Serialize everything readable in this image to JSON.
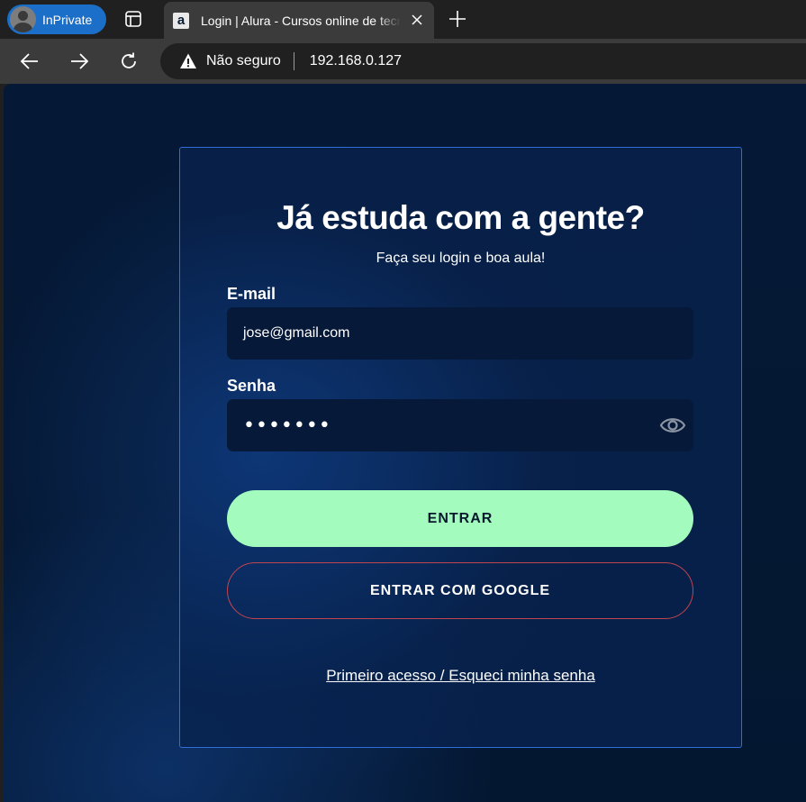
{
  "browser": {
    "inprivate_label": "InPrivate",
    "tab_title": "Login | Alura - Cursos online de tecnologia",
    "favicon_letter": "a",
    "security_label": "Não seguro",
    "url": "192.168.0.127"
  },
  "login": {
    "title": "Já estuda com a gente?",
    "subtitle": "Faça seu login e boa aula!",
    "email_label": "E-mail",
    "email_value": "jose@gmail.com",
    "password_label": "Senha",
    "password_mask": "•••••••",
    "submit_label": "ENTRAR",
    "google_label": "ENTRAR COM GOOGLE",
    "forgot_link": "Primeiro acesso / Esqueci minha senha"
  },
  "colors": {
    "accent_green": "#a3fbbe",
    "card_border": "#2e6ed6",
    "google_border": "#c1454f",
    "page_background": "#051936"
  },
  "icons": [
    "user-avatar-icon",
    "tabs-icon",
    "close-icon",
    "plus-icon",
    "back-icon",
    "forward-icon",
    "refresh-icon",
    "warning-icon",
    "eye-icon"
  ]
}
